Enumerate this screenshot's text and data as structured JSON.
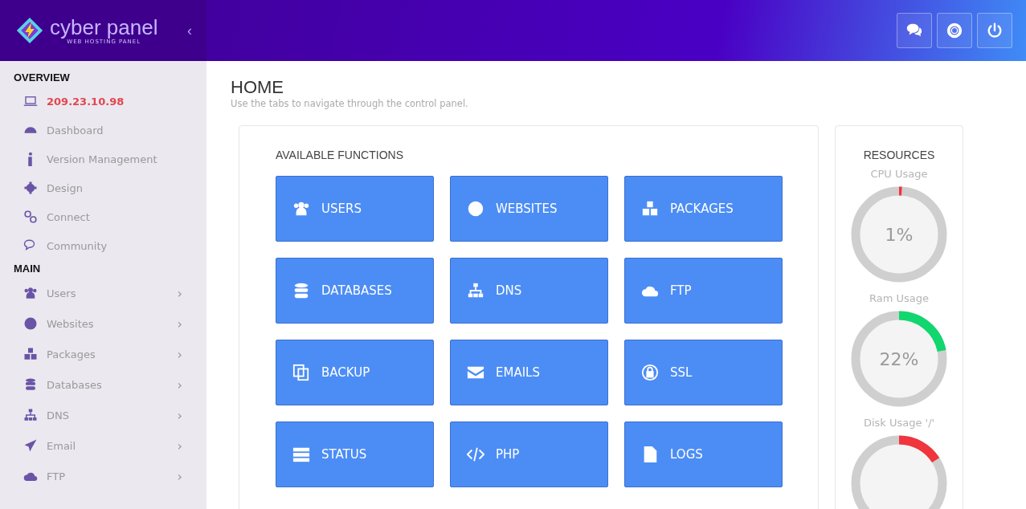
{
  "brand": {
    "name": "cyber panel",
    "tagline": "WEB HOSTING PANEL",
    "collapse": "‹"
  },
  "sidebar": {
    "sections": [
      {
        "title": "OVERVIEW",
        "items": [
          {
            "label": "209.23.10.98",
            "selected": true
          },
          {
            "label": "Dashboard",
            "selected": false
          },
          {
            "label": "Version Management",
            "selected": false
          },
          {
            "label": "Design",
            "selected": false
          },
          {
            "label": "Connect",
            "selected": false
          },
          {
            "label": "Community",
            "selected": false
          }
        ]
      },
      {
        "title": "MAIN",
        "items": [
          {
            "label": "Users",
            "selected": false,
            "chevron": "›"
          },
          {
            "label": "Websites",
            "selected": false,
            "chevron": "›"
          },
          {
            "label": "Packages",
            "selected": false,
            "chevron": "›"
          },
          {
            "label": "Databases",
            "selected": false,
            "chevron": "›"
          },
          {
            "label": "DNS",
            "selected": false,
            "chevron": "›"
          },
          {
            "label": "Email",
            "selected": false,
            "chevron": "›"
          },
          {
            "label": "FTP",
            "selected": false,
            "chevron": "›"
          }
        ]
      }
    ]
  },
  "page": {
    "title": "HOME",
    "subtitle": "Use the tabs to navigate through the control panel."
  },
  "functions": {
    "title": "AVAILABLE FUNCTIONS",
    "tiles": [
      "USERS",
      "WEBSITES",
      "PACKAGES",
      "DATABASES",
      "DNS",
      "FTP",
      "BACKUP",
      "EMAILS",
      "SSL",
      "STATUS",
      "PHP",
      "LOGS"
    ]
  },
  "resources": {
    "title": "RESOURCES",
    "gauges": [
      {
        "label": "CPU Usage",
        "reading": "1%",
        "level": 0.01,
        "color": "#f0353c"
      },
      {
        "label": "Ram Usage",
        "reading": "22%",
        "level": 0.22,
        "color": "#12d66e"
      },
      {
        "label": "Disk Usage '/'",
        "level": 0.16,
        "color": "#f0353c"
      }
    ]
  }
}
